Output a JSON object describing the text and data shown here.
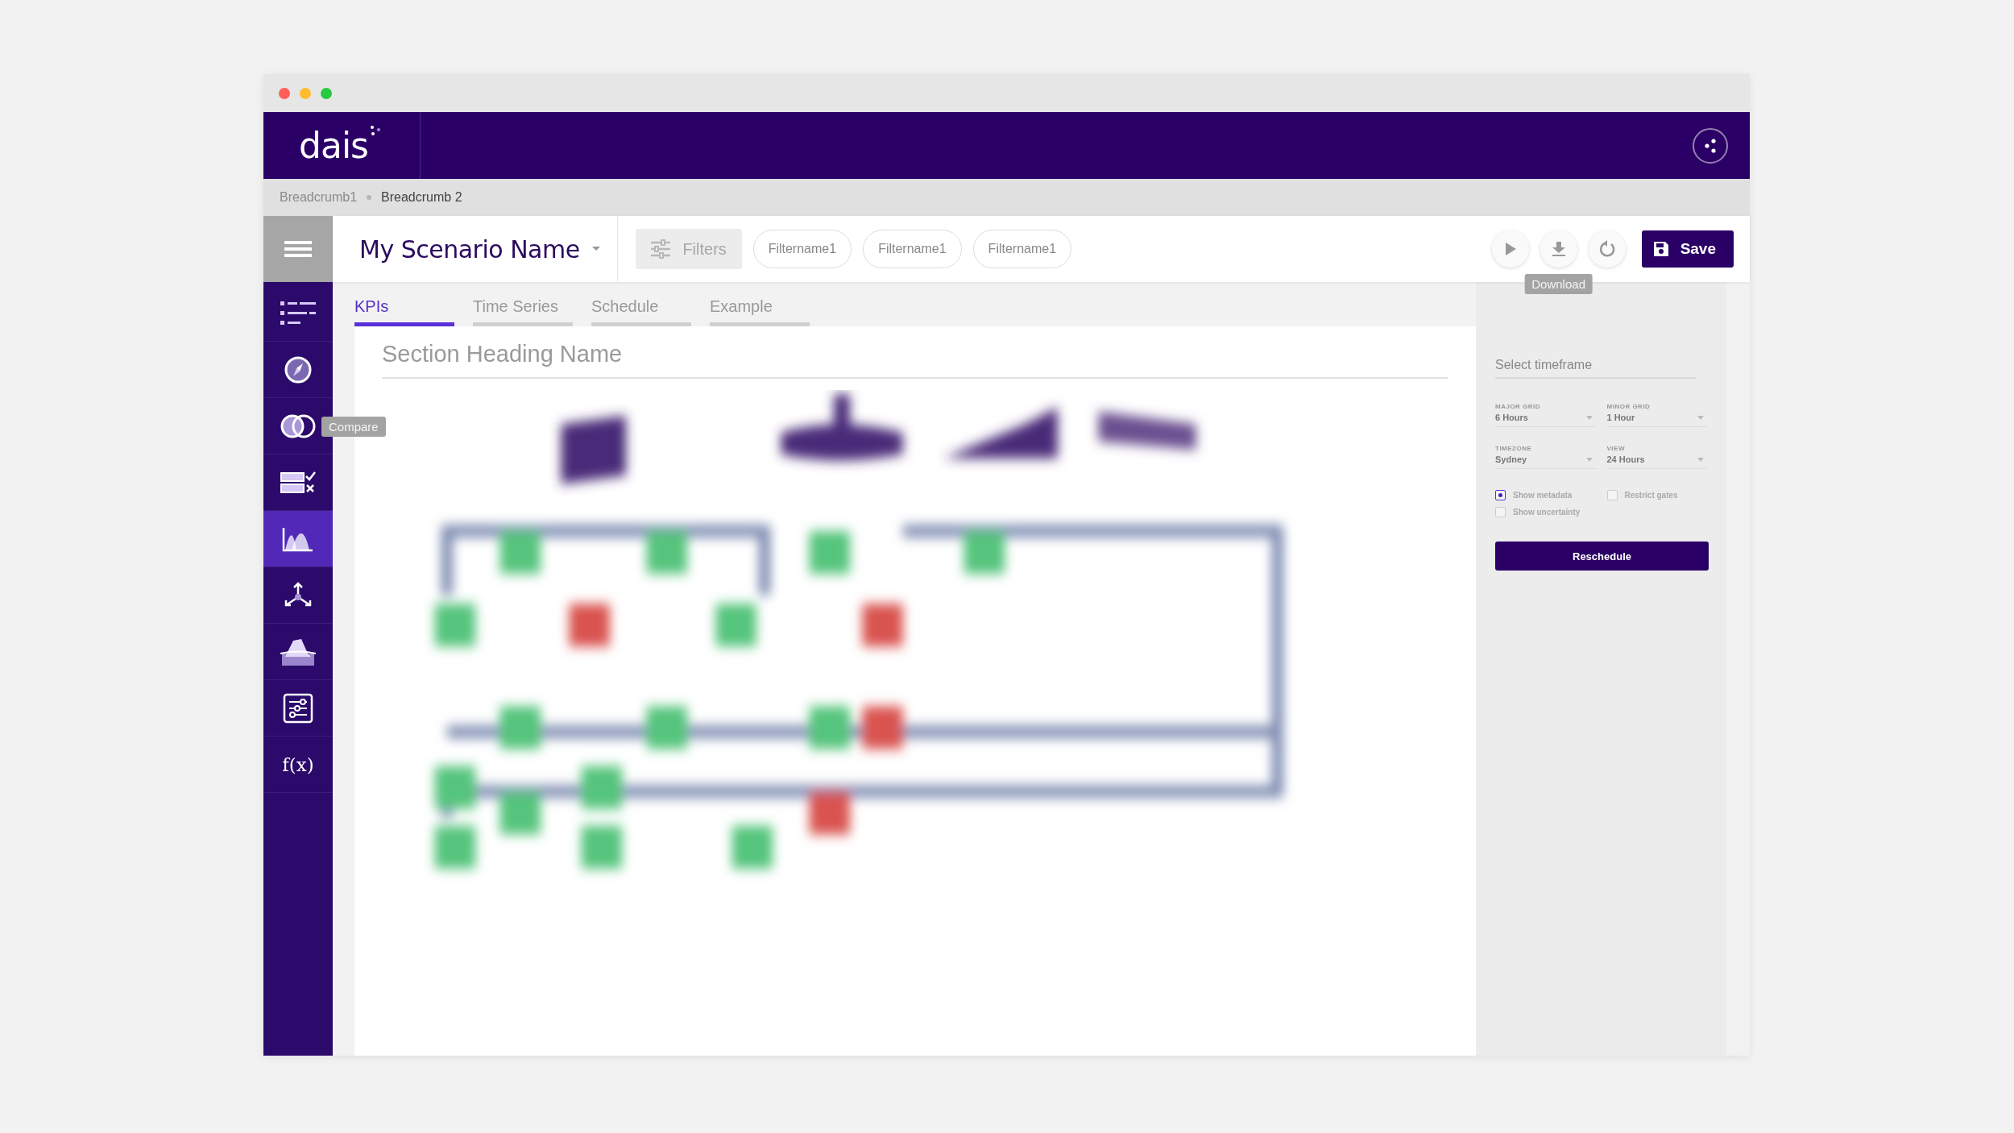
{
  "header": {
    "logo": "dais"
  },
  "breadcrumbs": [
    {
      "label": "Breadcrumb1",
      "selected": false
    },
    {
      "label": "Breadcrumb 2",
      "selected": true
    }
  ],
  "toolbar": {
    "title": "My Scenario Name",
    "filters_button": "Filters",
    "chips": [
      "Filtername1",
      "Filtername1",
      "Filtername1"
    ],
    "actions": [
      {
        "kind": "play"
      },
      {
        "kind": "download",
        "tooltip": "Download"
      },
      {
        "kind": "refresh"
      }
    ],
    "save_button": "Save"
  },
  "sidebar": {
    "items": [
      {
        "kind": "list",
        "selected": false
      },
      {
        "kind": "compass",
        "selected": false
      },
      {
        "kind": "compare",
        "selected": false,
        "tooltip": "Compare"
      },
      {
        "kind": "checklist",
        "selected": false
      },
      {
        "kind": "distribution",
        "selected": true
      },
      {
        "kind": "axes",
        "selected": false
      },
      {
        "kind": "iceberg",
        "selected": false
      },
      {
        "kind": "sliders",
        "selected": false
      },
      {
        "kind": "function",
        "selected": false,
        "label": "f(x)"
      }
    ]
  },
  "tabs": [
    {
      "label": "KPIs",
      "selected": true
    },
    {
      "label": "Time Series",
      "selected": false
    },
    {
      "label": "Schedule",
      "selected": false
    },
    {
      "label": "Example",
      "selected": false
    }
  ],
  "section": {
    "heading": "Section Heading Name"
  },
  "panel": {
    "timeframe": {
      "placeholder": "Select timeframe"
    },
    "fields": [
      {
        "label": "MAJOR GRID",
        "value": "6 Hours"
      },
      {
        "label": "MINOR GRID",
        "value": "1 Hour"
      },
      {
        "label": "TIMEZONE",
        "value": "Sydney"
      },
      {
        "label": "VIEW",
        "value": "24 Hours"
      }
    ],
    "options": [
      {
        "label": "Show metadata",
        "checked": true
      },
      {
        "label": "Restrict gates",
        "checked": false
      },
      {
        "label": "Show uncertainty",
        "checked": false
      }
    ],
    "button": "Reschedule"
  }
}
